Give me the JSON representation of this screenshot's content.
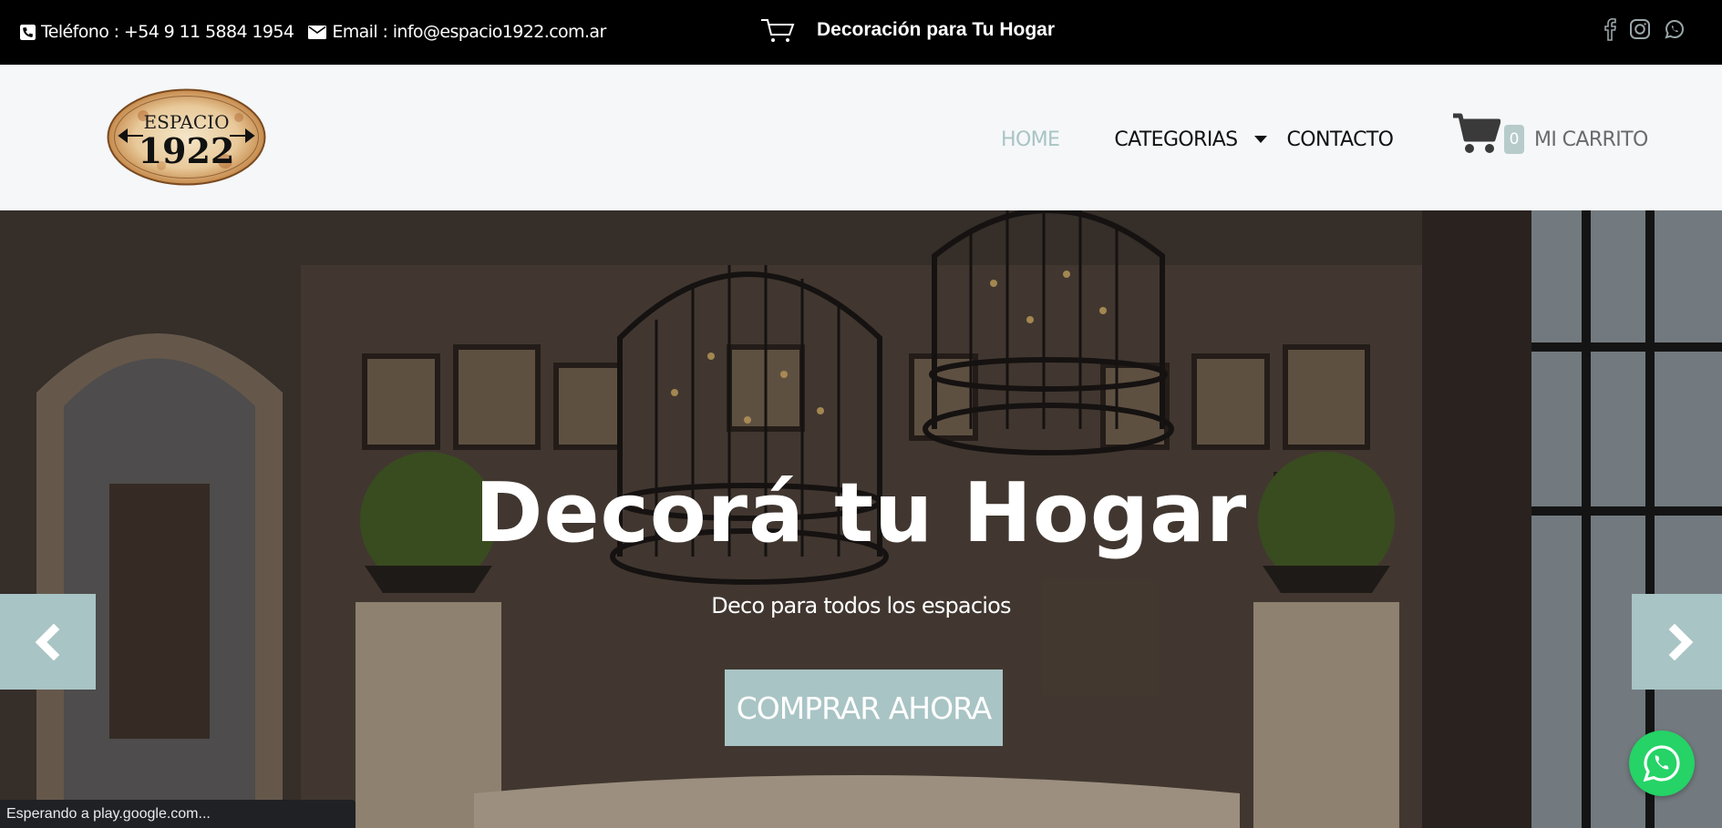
{
  "topbar": {
    "phone_label": "Teléfono : +54 9 11 5884 1954",
    "email_label": "Email : info@espacio1922.com.ar",
    "promo_text": "Decoración para Tu Hogar",
    "social": [
      "facebook-icon",
      "instagram-icon",
      "whatsapp-icon"
    ]
  },
  "header": {
    "logo_line1": "ESPACIO",
    "logo_line2": "1922",
    "nav": {
      "home": "HOME",
      "categorias": "CATEGORIAS",
      "contacto": "CONTACTO"
    },
    "cart": {
      "count": "0",
      "label": "MI CARRITO"
    }
  },
  "hero": {
    "title": "Decorá tu Hogar",
    "subtitle": "Deco para todos los espacios",
    "cta": "COMPRAR AHORA"
  },
  "status_bar": {
    "text": "Esperando a play.google.com..."
  },
  "colors": {
    "accent": "#a9c4c4",
    "topbar_bg": "#000000",
    "header_bg": "#f5f7f9",
    "whatsapp": "#25d366"
  }
}
